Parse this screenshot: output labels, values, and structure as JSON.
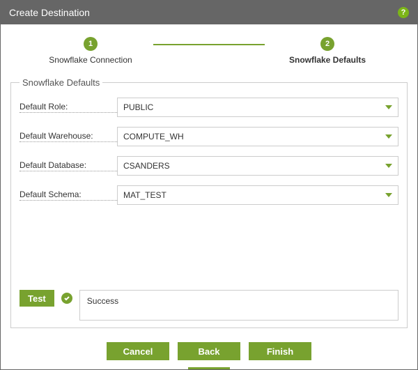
{
  "titlebar": {
    "title": "Create Destination"
  },
  "stepper": {
    "steps": [
      {
        "num": "1",
        "label": "Snowflake Connection"
      },
      {
        "num": "2",
        "label": "Snowflake Defaults"
      }
    ]
  },
  "fieldset_legend": "Snowflake Defaults",
  "fields": {
    "role": {
      "label": "Default Role:",
      "value": "PUBLIC"
    },
    "warehouse": {
      "label": "Default Warehouse:",
      "value": "COMPUTE_WH"
    },
    "database": {
      "label": "Default Database:",
      "value": "CSANDERS"
    },
    "schema": {
      "label": "Default Schema:",
      "value": "MAT_TEST"
    }
  },
  "test": {
    "button": "Test",
    "result": "Success"
  },
  "footer": {
    "cancel": "Cancel",
    "back": "Back",
    "finish": "Finish"
  }
}
